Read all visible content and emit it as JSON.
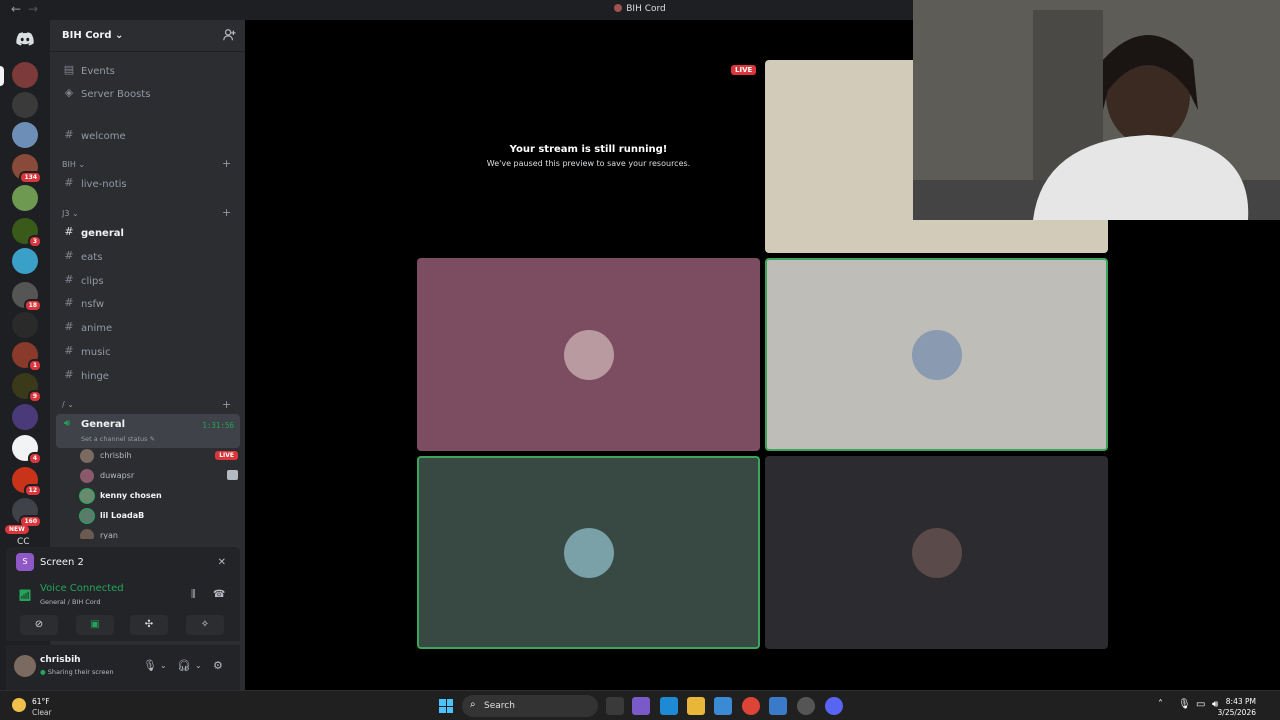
{
  "window": {
    "title": "BIH Cord",
    "back_icon": "←",
    "forward_icon": "→"
  },
  "guild_badges": [
    "134",
    "3",
    "18",
    "1",
    "9",
    "4",
    "12",
    "160"
  ],
  "guild_new": "NEW",
  "guild_cc": "CC",
  "server": {
    "name": "BIH Cord",
    "chevron": "⌄"
  },
  "sidebar": {
    "events": "Events",
    "boosts": "Server Boosts",
    "welcome": "welcome",
    "cat_bih": "BIH",
    "live_notis": "live-notis",
    "cat_j3": "J3",
    "general": "general",
    "eats": "eats",
    "clips": "clips",
    "nsfw": "nsfw",
    "anime": "anime",
    "music": "music",
    "hinge": "hinge",
    "cat_slash": "/",
    "hash": "#",
    "plus": "+"
  },
  "voice_channel": {
    "name": "General",
    "status": "Set a channel status",
    "time": "1:31:56",
    "users": [
      {
        "name": "chrisbih",
        "live": "LIVE"
      },
      {
        "name": "duwapsr"
      },
      {
        "name": "kenny chosen"
      },
      {
        "name": "lil LoadaB"
      },
      {
        "name": "ryan"
      }
    ]
  },
  "screen_share": {
    "initial": "S",
    "label": "Screen 2",
    "close": "✕"
  },
  "voice_connected": {
    "title": "Voice Connected",
    "subtitle": "General / BIH Cord"
  },
  "user_panel": {
    "name": "chrisbih",
    "status": "Sharing their screen"
  },
  "stage": {
    "live": "LIVE",
    "paused_title": "Your stream is still running!",
    "paused_sub": "We've paused this preview to save your resources."
  },
  "taskbar": {
    "temp": "61°F",
    "condition": "Clear",
    "search_label": "Search",
    "time": "8:43 PM",
    "date": "3/25/2026"
  },
  "colors": {
    "accent_green": "#23a55a",
    "live_red": "#da373c",
    "tile_mauve": "#7c4d61",
    "tile_gray": "#bebdb8",
    "tile_teal": "#384944",
    "tile_dark": "#2c2b2f",
    "tile_beige": "#d3cbb9"
  }
}
